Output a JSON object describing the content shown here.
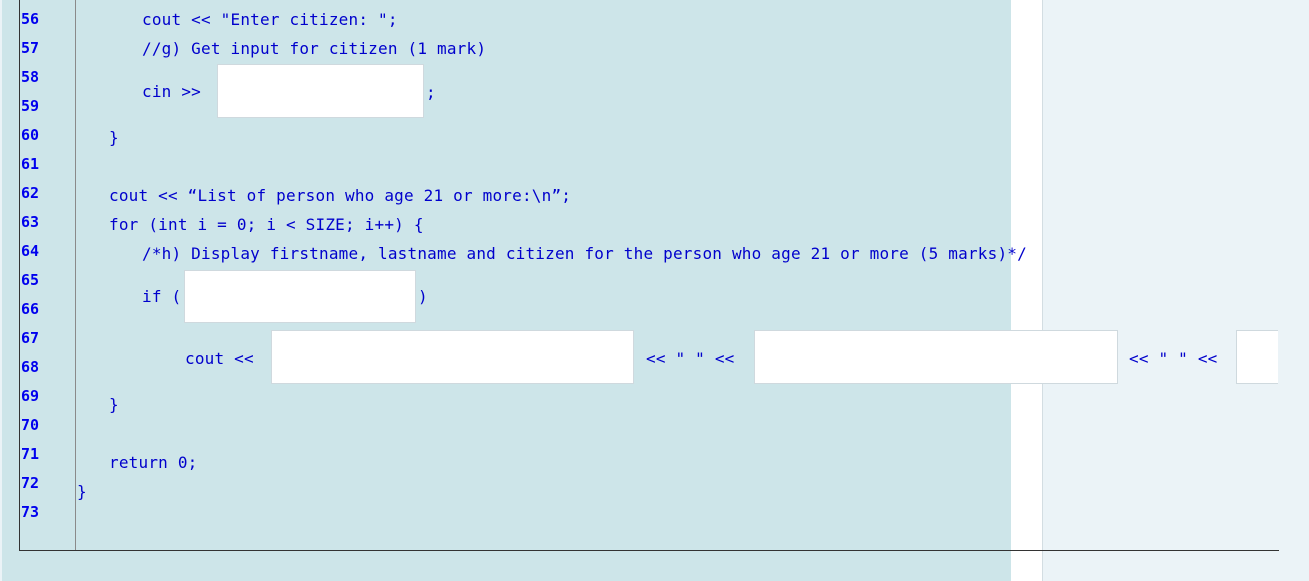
{
  "line_numbers": [
    "56",
    "57",
    "58",
    "59",
    "60",
    "61",
    "62",
    "63",
    "64",
    "65",
    "66",
    "67",
    "68",
    "69",
    "70",
    "71",
    "72",
    "73"
  ],
  "code": {
    "l56": "cout << \"Enter citizen: \";",
    "l57": "//g) Get input for citizen (1 mark)",
    "l58_prefix": "cin >>",
    "l58_suffix": ";",
    "l60": "}",
    "l62": "cout << “List of person who age 21 or more:\\n”;",
    "l63": "for (int i = 0; i < SIZE; i++) {",
    "l64": "/*h) Display firstname, lastname and citizen for the person who age 21 or more (5 marks)*/",
    "l65_prefix": "if (",
    "l65_suffix": ")",
    "l68_prefix": "cout <<",
    "l68_sep1": "<< \" \" <<",
    "l68_sep2": "<< \" \" <<",
    "l69": "}",
    "l71": "return 0;",
    "l72": "}"
  },
  "blanks": {
    "cin_citizen": "",
    "if_condition": "",
    "cout_firstname": "",
    "cout_lastname": "",
    "cout_citizen": ""
  },
  "colors": {
    "code_text": "#0000cc",
    "line_number": "#0000ee",
    "editor_bg": "#cde5e9",
    "page_bg": "#ebf3f7"
  }
}
